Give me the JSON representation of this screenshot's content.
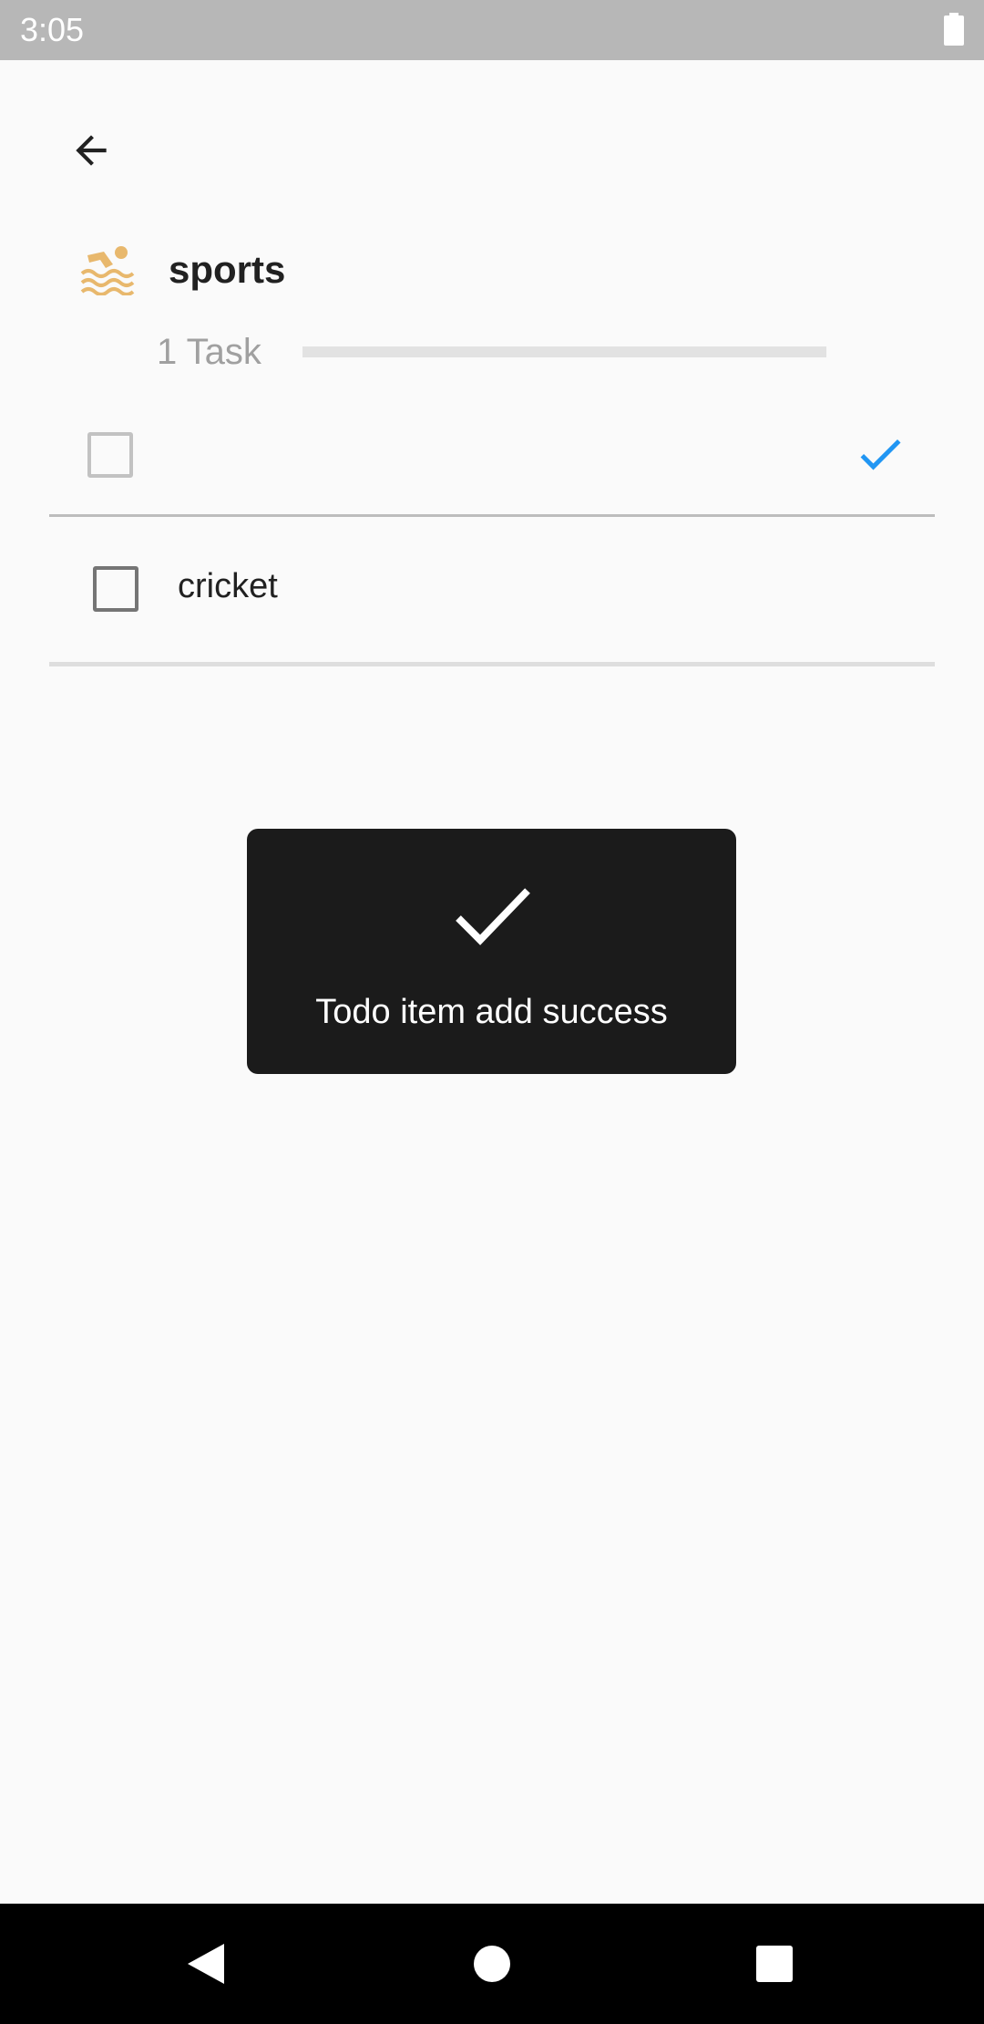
{
  "status_bar": {
    "time": "3:05"
  },
  "header": {
    "back_icon": "arrow-back-icon",
    "category_icon": "swimming-icon",
    "category_icon_color": "#e8b86d",
    "title": "sports",
    "task_count": "1 Task",
    "progress": 0
  },
  "new_item": {
    "value": "",
    "placeholder": "",
    "confirm_icon": "check-icon",
    "confirm_color": "#2196f3"
  },
  "todos": [
    {
      "label": "cricket",
      "checked": false
    }
  ],
  "toast": {
    "icon": "check-icon",
    "message": "Todo item add success"
  },
  "nav_bar": {
    "back_icon": "nav-back-icon",
    "home_icon": "nav-home-icon",
    "recents_icon": "nav-recents-icon"
  }
}
